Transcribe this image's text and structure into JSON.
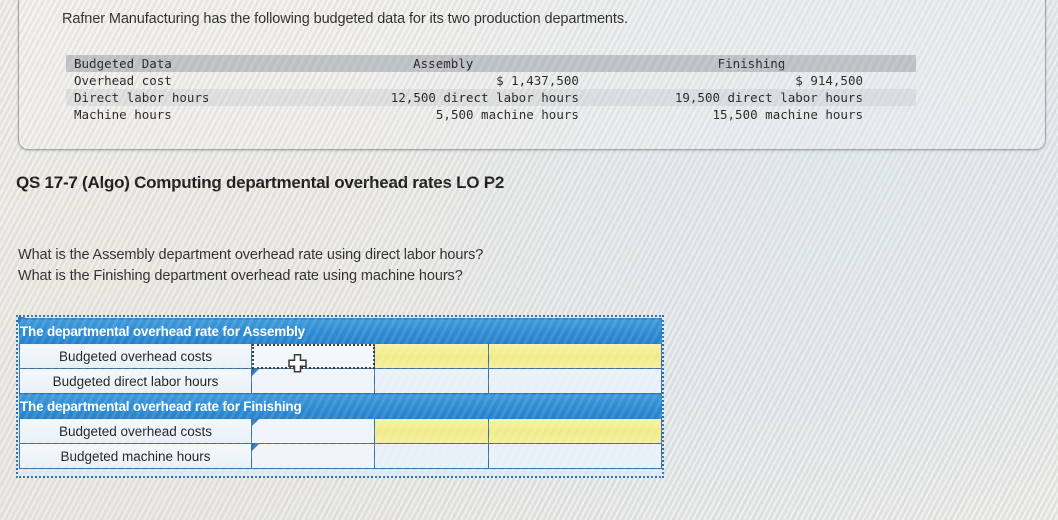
{
  "problem": {
    "intro": "Rafner Manufacturing has the following budgeted data for its two production departments.",
    "table": {
      "headers": {
        "label": "Budgeted Data",
        "assembly": "Assembly",
        "finishing": "Finishing"
      },
      "rows": [
        {
          "label": "Overhead cost",
          "assembly": "$ 1,437,500",
          "finishing": "$ 914,500"
        },
        {
          "label": "Direct labor hours",
          "assembly": "12,500 direct labor hours",
          "finishing": "19,500 direct labor hours"
        },
        {
          "label": "Machine hours",
          "assembly": "5,500 machine hours",
          "finishing": "15,500 machine hours"
        }
      ]
    }
  },
  "question": {
    "heading": "QS 17-7 (Algo) Computing departmental overhead rates LO P2",
    "line1": "What is the Assembly department overhead rate using direct labor hours?",
    "line2": "What is the Finishing department overhead rate using machine hours?"
  },
  "answer_sheet": {
    "sections": [
      {
        "title": "The departmental overhead rate for Assembly",
        "rows": [
          {
            "label": "Budgeted overhead costs",
            "input": "",
            "yellow1": "",
            "yellow2": ""
          },
          {
            "label": "Budgeted direct labor hours",
            "input": "",
            "blank1": "",
            "blank2": ""
          }
        ]
      },
      {
        "title": "The departmental overhead rate for Finishing",
        "rows": [
          {
            "label": "Budgeted overhead costs",
            "input": "",
            "yellow1": "",
            "yellow2": ""
          },
          {
            "label": "Budgeted machine hours",
            "input": "",
            "blank1": "",
            "blank2": ""
          }
        ]
      }
    ]
  },
  "colors": {
    "section_header_blue": "#2c8ad2",
    "input_yellow": "#f2ea86",
    "cell_border": "#3b6f9e",
    "table_header_gray": "#bcc0c4"
  }
}
